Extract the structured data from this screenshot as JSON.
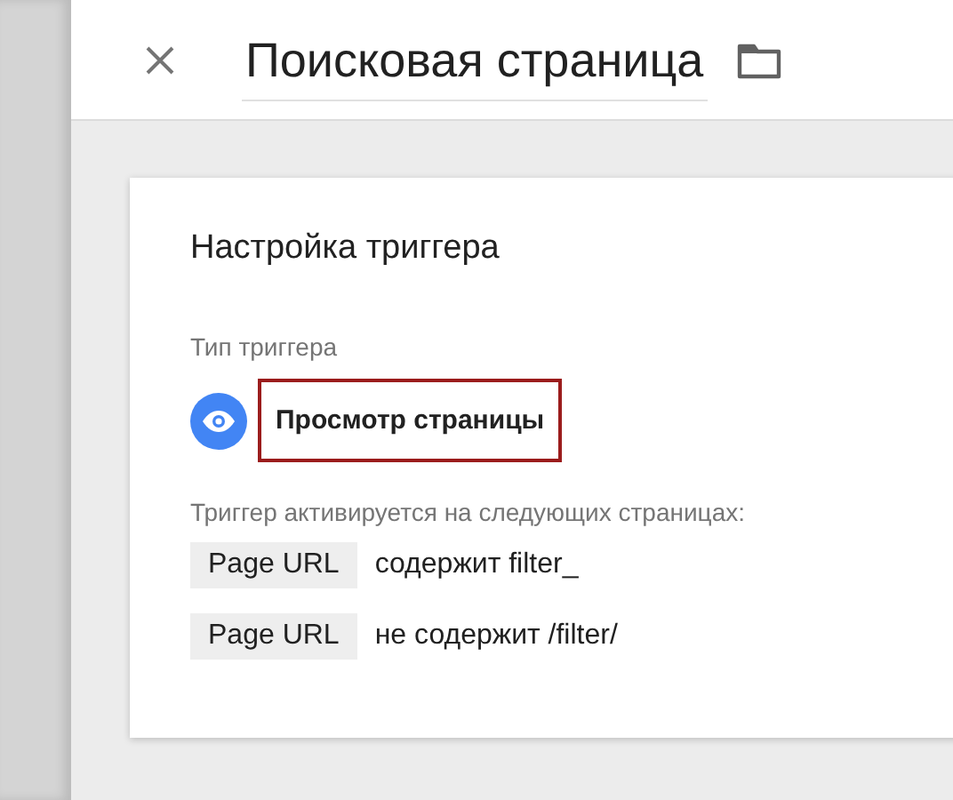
{
  "header": {
    "title": "Поисковая страница"
  },
  "card": {
    "title": "Настройка триггера",
    "trigger_type": {
      "label": "Тип триггера",
      "name": "Просмотр страницы",
      "highlighted": true
    },
    "conditions_label": "Триггер активируется на следующих страницах:",
    "conditions": [
      {
        "variable": "Page URL",
        "rule": "содержит filter_"
      },
      {
        "variable": "Page URL",
        "rule": "не содержит /filter/"
      }
    ]
  }
}
